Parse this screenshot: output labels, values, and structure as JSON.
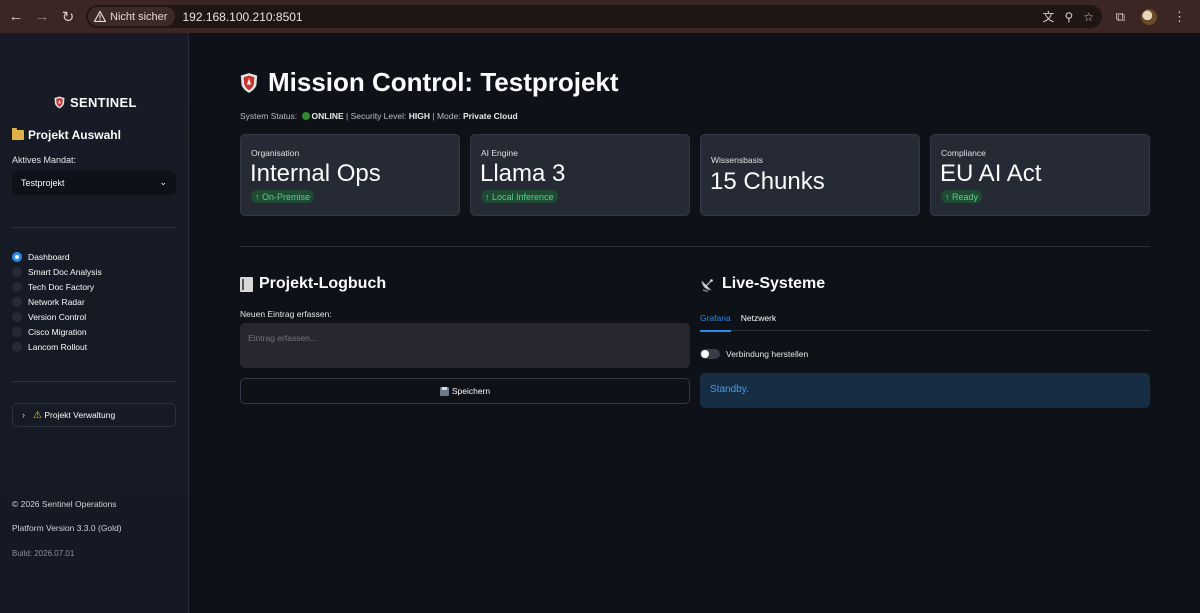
{
  "browser": {
    "security_label": "Nicht sicher",
    "url": "192.168.100.210:8501"
  },
  "sidebar": {
    "brand": "SENTINEL",
    "section_title": "Projekt Auswahl",
    "mandate_label": "Aktives Mandat:",
    "mandate_value": "Testprojekt",
    "nav_items": [
      {
        "label": "Dashboard",
        "selected": true
      },
      {
        "label": "Smart Doc Analysis",
        "selected": false
      },
      {
        "label": "Tech Doc Factory",
        "selected": false
      },
      {
        "label": "Network Radar",
        "selected": false
      },
      {
        "label": "Version Control",
        "selected": false
      },
      {
        "label": "Cisco Migration",
        "selected": false
      },
      {
        "label": "Lancom Rollout",
        "selected": false
      }
    ],
    "expander_label": "Projekt Verwaltung",
    "footer": {
      "copyright": "© 2026 Sentinel Operations",
      "version": "Platform Version 3.3.0 (Gold)",
      "build": "Build: 2026.07.01"
    }
  },
  "main": {
    "title": "Mission Control: Testprojekt",
    "status": {
      "system_label": "System Status:",
      "system_value": "ONLINE",
      "security_label": "| Security Level:",
      "security_value": "HIGH",
      "mode_label": "| Mode:",
      "mode_value": "Private Cloud"
    },
    "metrics": [
      {
        "label": "Organisation",
        "value": "Internal Ops",
        "delta": "↑ On-Premise"
      },
      {
        "label": "AI Engine",
        "value": "Llama 3",
        "delta": "↑ Local Inference"
      },
      {
        "label": "Wissensbasis",
        "value": "15 Chunks",
        "delta": null
      },
      {
        "label": "Compliance",
        "value": "EU AI Act",
        "delta": "↑ Ready"
      }
    ],
    "logbook": {
      "title": "Projekt-Logbuch",
      "input_label": "Neuen Eintrag erfassen:",
      "placeholder": "Eintrag erfassen...",
      "save_label": "Speichern"
    },
    "live": {
      "title": "Live-Systeme",
      "tabs": [
        "Grafana",
        "Netzwerk"
      ],
      "toggle_label": "Verbindung herstellen",
      "info_text": "Standby."
    }
  },
  "colors": {
    "accent": "#2b8be8",
    "background": "#0e1117",
    "delta_green": "#5bd08a"
  }
}
